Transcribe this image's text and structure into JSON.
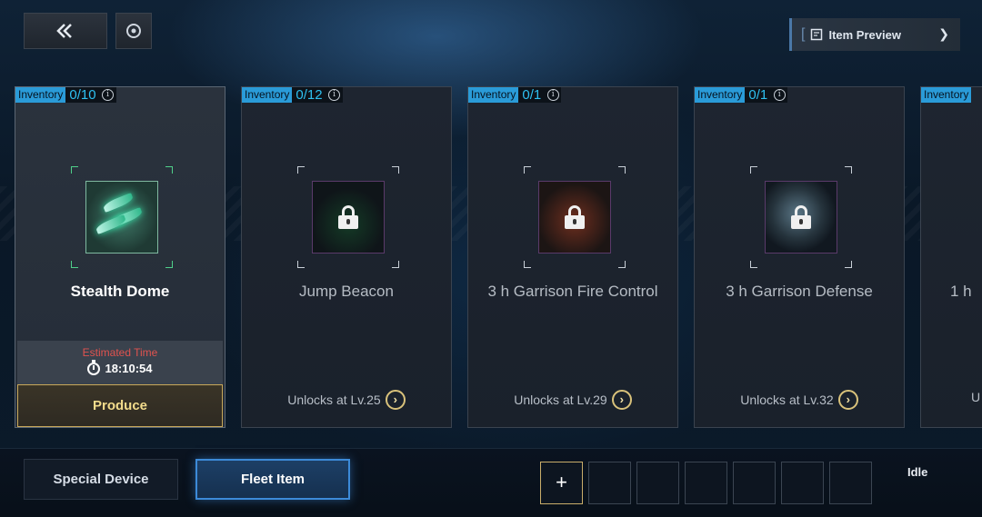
{
  "top": {
    "back_icon": "double-chevron-left-icon",
    "settings_icon": "target-circle-icon",
    "item_preview_label": "Item Preview"
  },
  "cards": [
    {
      "inventory_label": "Inventory",
      "count": "0/10",
      "name": "Stealth Dome",
      "estimated_label": "Estimated Time",
      "time": "18:10:54",
      "produce_label": "Produce"
    },
    {
      "inventory_label": "Inventory",
      "count": "0/12",
      "name": "Jump Beacon",
      "unlock": "Unlocks at Lv.25"
    },
    {
      "inventory_label": "Inventory",
      "count": "0/1",
      "name": "3 h Garrison Fire Control",
      "unlock": "Unlocks at Lv.29"
    },
    {
      "inventory_label": "Inventory",
      "count": "0/1",
      "name": "3 h Garrison Defense",
      "unlock": "Unlocks at Lv.32"
    },
    {
      "inventory_label": "Inventory",
      "name": "1 h",
      "unlock": "U"
    }
  ],
  "tabs": {
    "special": "Special Device",
    "fleet": "Fleet Item"
  },
  "queue": {
    "add_symbol": "+",
    "status": "Idle"
  },
  "colors": {
    "inventory_badge": "#2a9bd8",
    "count_text": "#2ec0f0",
    "produce_border": "#c9a95a",
    "estimated_label": "#e0534f",
    "active_tab": "#3c8ad8"
  }
}
